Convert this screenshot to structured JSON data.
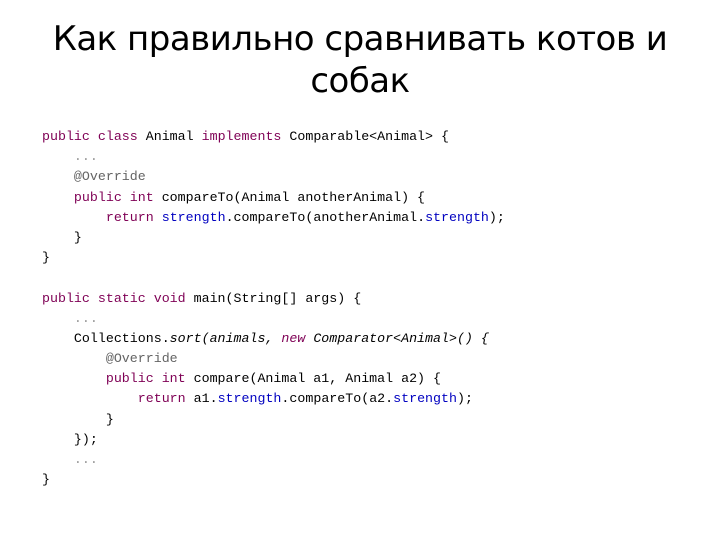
{
  "slide": {
    "title": "Как правильно сравнивать котов и собак"
  },
  "code": {
    "lines": [
      [
        {
          "t": "public class",
          "c": "kw"
        },
        {
          "t": " Animal "
        },
        {
          "t": "implements",
          "c": "kw"
        },
        {
          "t": " Comparable<Animal> {"
        }
      ],
      [
        {
          "t": "    "
        },
        {
          "t": "...",
          "c": "dots"
        }
      ],
      [
        {
          "t": "    "
        },
        {
          "t": "@Override",
          "c": "ann"
        }
      ],
      [
        {
          "t": "    "
        },
        {
          "t": "public int",
          "c": "kw"
        },
        {
          "t": " compareTo(Animal anotherAnimal) {"
        }
      ],
      [
        {
          "t": "        "
        },
        {
          "t": "return",
          "c": "kw"
        },
        {
          "t": " "
        },
        {
          "t": "strength",
          "c": "fld"
        },
        {
          "t": ".compareTo(anotherAnimal."
        },
        {
          "t": "strength",
          "c": "fld"
        },
        {
          "t": ");"
        }
      ],
      [
        {
          "t": "    }"
        }
      ],
      [
        {
          "t": "}"
        }
      ],
      [
        {
          "t": ""
        }
      ],
      [
        {
          "t": "public static void",
          "c": "kw"
        },
        {
          "t": " main(String[] args) {"
        }
      ],
      [
        {
          "t": "    "
        },
        {
          "t": "...",
          "c": "dots"
        }
      ],
      [
        {
          "t": "    Collections."
        },
        {
          "t": "sort",
          "c": "it"
        },
        {
          "t": "(animals, ",
          "c": "it"
        },
        {
          "t": "new",
          "c": "kw it"
        },
        {
          "t": " Comparator<Animal>() {",
          "c": "it"
        }
      ],
      [
        {
          "t": "        "
        },
        {
          "t": "@Override",
          "c": "ann"
        }
      ],
      [
        {
          "t": "        "
        },
        {
          "t": "public int",
          "c": "kw"
        },
        {
          "t": " compare(Animal a1, Animal a2) {"
        }
      ],
      [
        {
          "t": "            "
        },
        {
          "t": "return",
          "c": "kw"
        },
        {
          "t": " a1."
        },
        {
          "t": "strength",
          "c": "fld"
        },
        {
          "t": ".compareTo(a2."
        },
        {
          "t": "strength",
          "c": "fld"
        },
        {
          "t": ");"
        }
      ],
      [
        {
          "t": "        }"
        }
      ],
      [
        {
          "t": "    });"
        }
      ],
      [
        {
          "t": "    "
        },
        {
          "t": "...",
          "c": "dots"
        }
      ],
      [
        {
          "t": "}"
        }
      ]
    ]
  }
}
